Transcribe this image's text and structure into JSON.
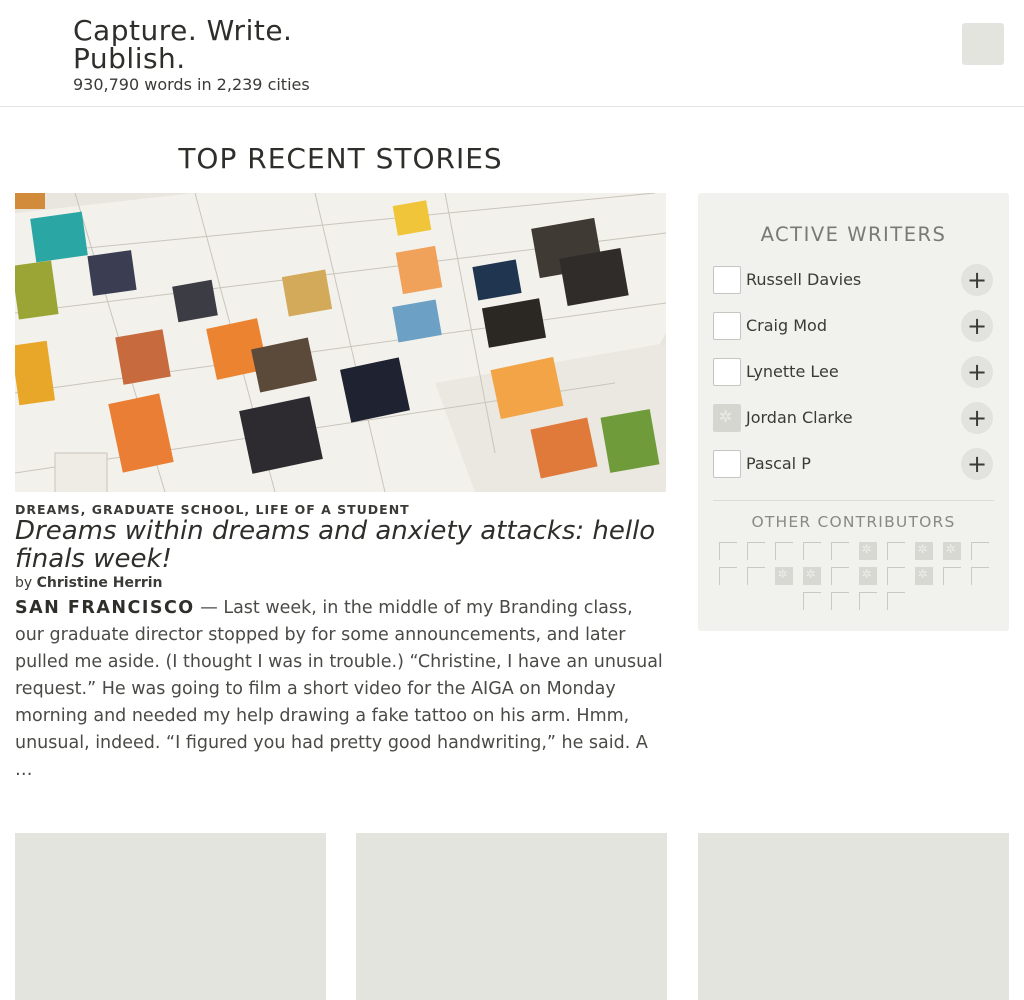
{
  "header": {
    "title": "Capture. Write. Publish.",
    "stats": "930,790 words in 2,239 cities"
  },
  "main": {
    "section_heading": "TOP RECENT STORIES",
    "feature": {
      "tags": "DREAMS, GRADUATE SCHOOL, LIFE OF A STUDENT",
      "title": "Dreams within dreams and anxiety attacks: hello finals week!",
      "byline_prefix": "by",
      "author": "Christine Herrin",
      "dateline": "SAN FRANCISCO",
      "excerpt": " — Last week, in the middle of my Branding class, our graduate director stopped by for some announcements, and later pulled me aside. (I thought I was in trouble.) “Christine, I have an unusual request.” He was going to film a short video for the AIGA on Monday morning and needed my help drawing a fake tattoo on his arm. Hmm, unusual, indeed. “I figured you had pretty good handwriting,” he said. A …"
    }
  },
  "sidebar": {
    "heading": "ACTIVE WRITERS",
    "writers": [
      {
        "name": "Russell Davies",
        "avatar": "blank",
        "action": "+"
      },
      {
        "name": "Craig Mod",
        "avatar": "blank",
        "action": "+"
      },
      {
        "name": "Lynette Lee",
        "avatar": "blank",
        "action": "+"
      },
      {
        "name": "Jordan Clarke",
        "avatar": "pattern",
        "action": "+"
      },
      {
        "name": "Pascal P",
        "avatar": "blank",
        "action": "+"
      }
    ],
    "contributors_heading": "OTHER CONTRIBUTORS",
    "contributors": [
      "blank",
      "blank",
      "blank",
      "blank",
      "blank",
      "pattern",
      "blank",
      "pattern",
      "pattern",
      "blank",
      "blank",
      "blank",
      "pattern",
      "pattern",
      "blank",
      "pattern",
      "blank",
      "pattern",
      "blank",
      "blank",
      "blank",
      "blank",
      "blank",
      "blank"
    ]
  },
  "colors": {
    "accent_panel": "#f1f1ed",
    "placeholder": "#e4e4df",
    "text": "#333330"
  }
}
